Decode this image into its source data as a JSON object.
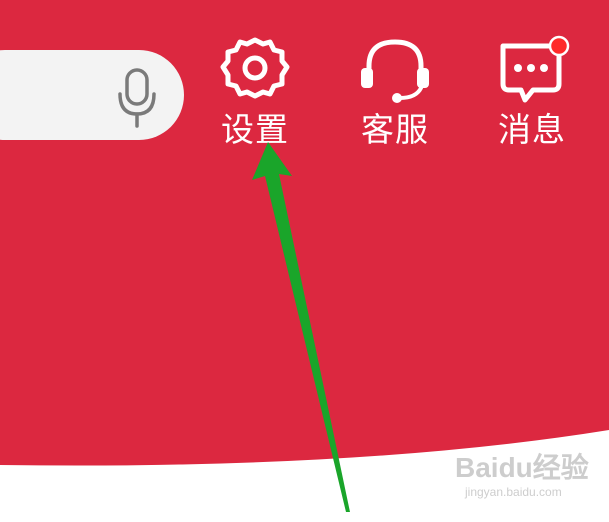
{
  "header": {
    "search": {
      "icon": "microphone-icon"
    },
    "actions": [
      {
        "label": "设置",
        "icon": "gear-icon"
      },
      {
        "label": "客服",
        "icon": "headset-icon"
      },
      {
        "label": "消息",
        "icon": "chat-bubble-icon",
        "has_badge": true
      }
    ]
  },
  "colors": {
    "background_red": "#dc2840",
    "search_bg": "#f3f3f3",
    "icon_white": "#ffffff",
    "badge_red": "#ff2a2a",
    "arrow_green": "#1aa52a"
  },
  "watermark": {
    "brand": "Baidu经验",
    "url": "jingyan.baidu.com"
  }
}
